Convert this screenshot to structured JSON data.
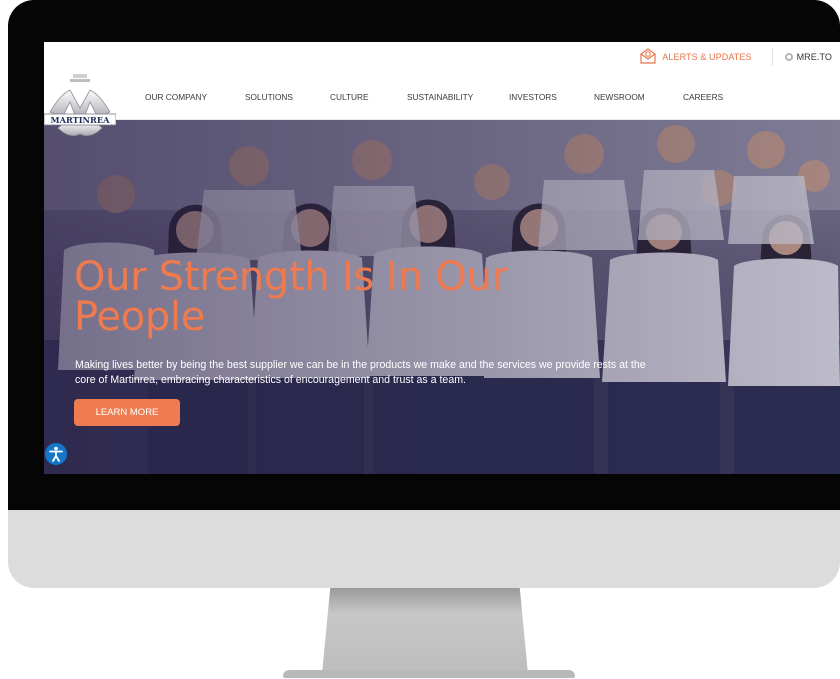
{
  "topbar": {
    "alerts_label": "ALERTS & UPDATES",
    "ticker_label": "MRE.TO"
  },
  "nav": {
    "items": [
      {
        "label": "OUR COMPANY"
      },
      {
        "label": "SOLUTIONS"
      },
      {
        "label": "CULTURE"
      },
      {
        "label": "SUSTAINABILITY"
      },
      {
        "label": "INVESTORS"
      },
      {
        "label": "NEWSROOM"
      },
      {
        "label": "CAREERS"
      }
    ]
  },
  "logo": {
    "text": "MARTINREA"
  },
  "hero": {
    "headline": "Our Strength Is In Our People",
    "subtext": "Making lives better by being the best supplier we can be in the products we make and the services we provide rests at the core of Martinrea, embracing characteristics of encouragement and trust as a team.",
    "button_label": "LEARN MORE"
  },
  "colors": {
    "accent": "#ef7b50",
    "bezel": "#050505",
    "chin": "#dcdcdc",
    "accessibility": "#1677c9"
  },
  "icons": {
    "alerts": "envelope-alert-icon",
    "ticker": "ticker-dot-icon",
    "accessibility": "accessibility-icon"
  }
}
